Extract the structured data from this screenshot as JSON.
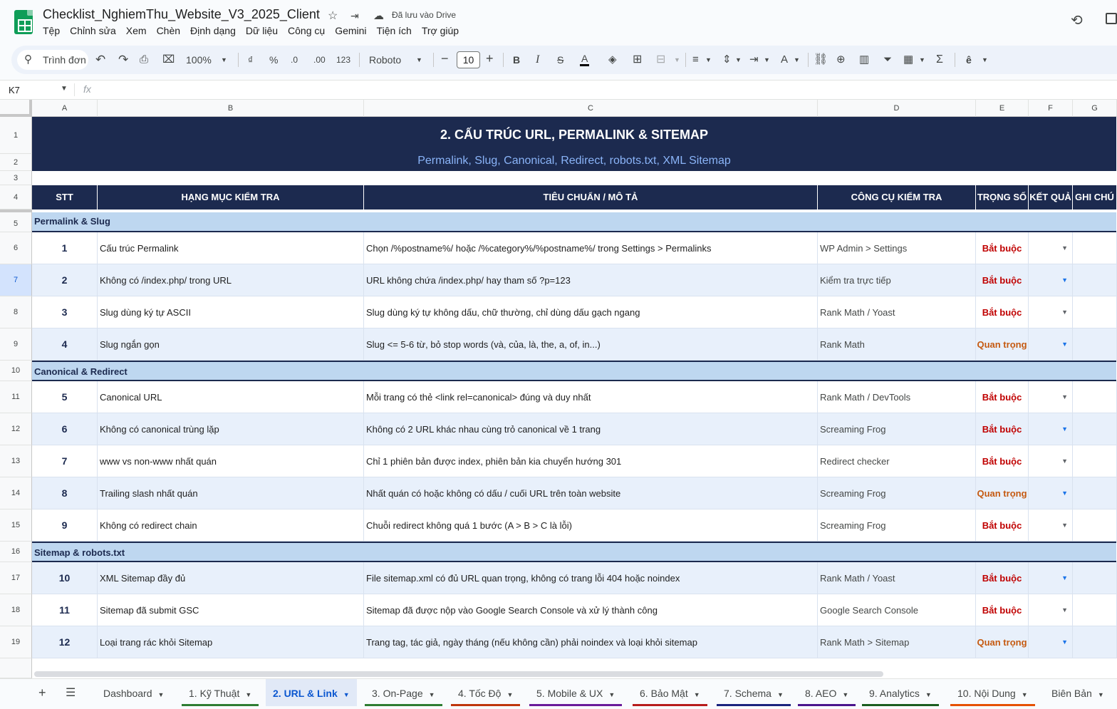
{
  "app": {
    "doc_title": "Checklist_NghiemThu_Website_V3_2025_Client",
    "saved_status": "Đã lưu vào Drive",
    "menu": [
      "Tệp",
      "Chỉnh sửa",
      "Xem",
      "Chèn",
      "Định dạng",
      "Dữ liệu",
      "Công cụ",
      "Gemini",
      "Tiện ích",
      "Trợ giúp"
    ]
  },
  "toolbar": {
    "search_label": "Trình đơn",
    "zoom": "100%",
    "currency": "₫",
    "percent": "%",
    "dec_decrease": ".0",
    "dec_increase": ".00",
    "number_format": "123",
    "font": "Roboto",
    "font_size": "10"
  },
  "formula_bar": {
    "cell_ref": "K7",
    "fx": "fx",
    "content": ""
  },
  "columns": [
    "A",
    "B",
    "C",
    "D",
    "E",
    "F",
    "G"
  ],
  "rows": [
    "1",
    "2",
    "3",
    "4",
    "5",
    "6",
    "7",
    "8",
    "9",
    "10",
    "11",
    "12",
    "13",
    "14",
    "15",
    "16",
    "17",
    "18",
    "19"
  ],
  "banner": {
    "title": "2. CẤU TRÚC URL, PERMALINK & SITEMAP",
    "subtitle": "Permalink, Slug, Canonical, Redirect, robots.txt, XML Sitemap"
  },
  "headers": {
    "stt": "STT",
    "item": "HẠNG MỤC KIỂM TRA",
    "criteria": "TIÊU CHUẨN / MÔ TẢ",
    "tool": "CÔNG CỤ KIỂM TRA",
    "weight": "TRỌNG SỐ",
    "result": "KẾT QUẢ",
    "note": "GHI CHÚ"
  },
  "sections": [
    {
      "title": "Permalink & Slug"
    },
    {
      "title": "Canonical & Redirect"
    },
    {
      "title": "Sitemap & robots.txt"
    }
  ],
  "items": [
    {
      "stt": "1",
      "item": "Cấu trúc Permalink",
      "criteria": "Chọn /%postname%/ hoặc /%category%/%postname%/ trong Settings > Permalinks",
      "tool": "WP Admin > Settings",
      "weight": "Bắt buộc"
    },
    {
      "stt": "2",
      "item": "Không có /index.php/ trong URL",
      "criteria": "URL không chứa /index.php/ hay tham số ?p=123",
      "tool": "Kiểm tra trực tiếp",
      "weight": "Bắt buộc"
    },
    {
      "stt": "3",
      "item": "Slug dùng ký tự ASCII",
      "criteria": "Slug dùng ký tự không dấu, chữ thường, chỉ dùng dấu gạch ngang",
      "tool": "Rank Math / Yoast",
      "weight": "Bắt buộc"
    },
    {
      "stt": "4",
      "item": "Slug ngắn gọn",
      "criteria": "Slug <= 5-6 từ, bỏ stop words (và, của, là, the, a, of, in...)",
      "tool": "Rank Math",
      "weight": "Quan trọng"
    },
    {
      "stt": "5",
      "item": "Canonical URL",
      "criteria": "Mỗi trang có thẻ <link rel=canonical> đúng và duy nhất",
      "tool": "Rank Math / DevTools",
      "weight": "Bắt buộc"
    },
    {
      "stt": "6",
      "item": "Không có canonical trùng lặp",
      "criteria": "Không có 2 URL khác nhau cùng trỏ canonical về 1 trang",
      "tool": "Screaming Frog",
      "weight": "Bắt buộc"
    },
    {
      "stt": "7",
      "item": "www vs non-www nhất quán",
      "criteria": "Chỉ 1 phiên bản được index, phiên bản kia chuyển hướng 301",
      "tool": "Redirect checker",
      "weight": "Bắt buộc"
    },
    {
      "stt": "8",
      "item": "Trailing slash nhất quán",
      "criteria": "Nhất quán có hoặc không có dấu / cuối URL trên toàn website",
      "tool": "Screaming Frog",
      "weight": "Quan trọng"
    },
    {
      "stt": "9",
      "item": "Không có redirect chain",
      "criteria": "Chuỗi redirect không quá 1 bước (A > B > C là lỗi)",
      "tool": "Screaming Frog",
      "weight": "Bắt buộc"
    },
    {
      "stt": "10",
      "item": "XML Sitemap đầy đủ",
      "criteria": "File sitemap.xml có đủ URL quan trọng, không có trang lỗi 404 hoặc noindex",
      "tool": "Rank Math / Yoast",
      "weight": "Bắt buộc"
    },
    {
      "stt": "11",
      "item": "Sitemap đã submit GSC",
      "criteria": "Sitemap đã được nộp vào Google Search Console và xử lý thành công",
      "tool": "Google Search Console",
      "weight": "Bắt buộc"
    },
    {
      "stt": "12",
      "item": "Loại trang rác khỏi Sitemap",
      "criteria": "Trang tag, tác giả, ngày tháng (nếu không cần) phải noindex và loại khỏi sitemap",
      "tool": "Rank Math > Sitemap",
      "weight": "Quan trọng"
    }
  ],
  "colors": {
    "navy": "#1c2a4f",
    "section_bg": "#bed7f0",
    "alt_row": "#e8f0fb",
    "required": "#c00000",
    "important": "#c55a11"
  },
  "sheet_tabs": [
    "Dashboard",
    "1. Kỹ Thuật",
    "2. URL & Link",
    "3. On-Page",
    "4. Tốc Độ",
    "5. Mobile & UX",
    "6. Bảo Mật",
    "7. Schema",
    "8. AEO",
    "9. Analytics",
    "10. Nội Dung",
    "Biên Bản"
  ],
  "active_tab": "2. URL & Link"
}
